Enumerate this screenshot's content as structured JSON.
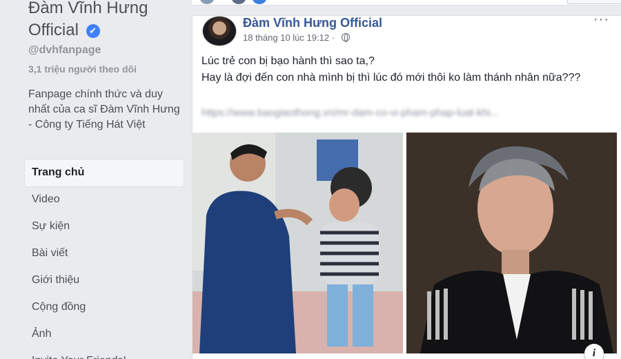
{
  "page": {
    "name": "Đàm Vĩnh Hưng Official",
    "verified_mark": "✔",
    "handle": "@dvhfanpage",
    "followers": "3,1 triệu người theo dõi",
    "about": "Fanpage chính thức và duy nhất của ca sĩ Đàm Vĩnh Hưng - Công ty Tiếng Hát Việt"
  },
  "nav": {
    "items": [
      {
        "label": "Trang chủ",
        "active": true
      },
      {
        "label": "Video"
      },
      {
        "label": "Sự kiện"
      },
      {
        "label": "Bài viết"
      },
      {
        "label": "Giới thiệu"
      },
      {
        "label": "Cộng đồng"
      },
      {
        "label": "Ảnh"
      },
      {
        "label": "Invite Your Friends!"
      }
    ]
  },
  "post": {
    "author": "Đàm Vĩnh Hưng Official",
    "timestamp": "18 tháng 10 lúc 19:12 ·",
    "more_label": "···",
    "lines": [
      "Lúc trẻ con bị bạo hành thì sao ta,?",
      "Hay là đợi đến con nhà mình bị thì lúc đó mới thôi ko làm thánh nhân nữa???"
    ],
    "link_text": "https://www.baogiaothong.vn/mr-dam-co-vi-pham-phap-luat-khi...",
    "info_label": "i"
  },
  "icons": {
    "verified": "verified-badge-icon",
    "globe": "globe-icon",
    "more": "more-options-icon",
    "info": "info-icon"
  },
  "colors": {
    "link_blue": "#365899",
    "verified_blue": "#4080ff",
    "background": "#e9ebee"
  }
}
